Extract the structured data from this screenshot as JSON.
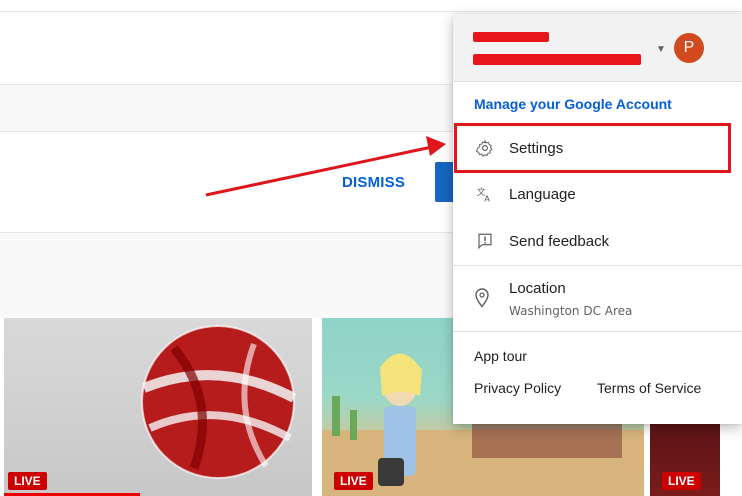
{
  "page": {
    "dismiss_label": "DISMISS",
    "thumbnails": [
      {
        "badge": "LIVE"
      },
      {
        "badge": "LIVE"
      },
      {
        "badge": "LIVE"
      }
    ]
  },
  "account_menu": {
    "avatar_letter": "P",
    "manage_account": "Manage your Google Account",
    "items": [
      {
        "label": "Settings",
        "icon": "gear-icon"
      },
      {
        "label": "Language",
        "icon": "translate-icon"
      },
      {
        "label": "Send feedback",
        "icon": "feedback-icon"
      }
    ],
    "location": {
      "label": "Location",
      "value": "Washington DC Area",
      "icon": "location-pin-icon"
    },
    "footer": {
      "app_tour": "App tour",
      "privacy": "Privacy Policy",
      "terms": "Terms of Service"
    }
  },
  "colors": {
    "accent_blue": "#065fd4",
    "annotation_red": "#e0161c",
    "avatar": "#d14a1d",
    "live_red": "#cc0000"
  }
}
